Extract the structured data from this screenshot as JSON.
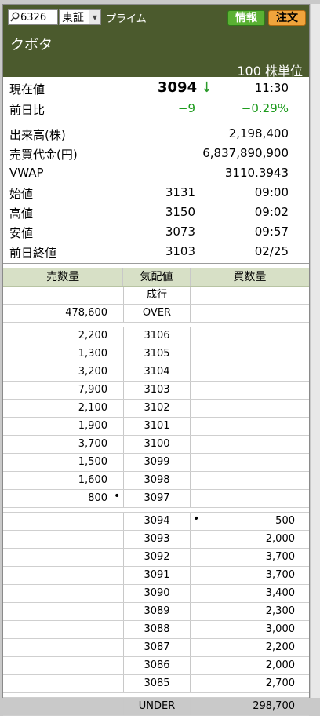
{
  "toolbar": {
    "stock_code": "6326",
    "market": "東証",
    "segment": "プライム",
    "info_button": "情報",
    "order_button": "注文"
  },
  "company": "クボタ",
  "unit": "100 株単位",
  "price": {
    "label_current": "現在値",
    "current": "3094",
    "arrow": "↓",
    "time": "11:30",
    "label_change": "前日比",
    "change": "−9",
    "change_pct": "−0.29%"
  },
  "stats": [
    {
      "label": "出来高(株)",
      "mid": "",
      "right": "2,198,400"
    },
    {
      "label": "売買代金(円)",
      "mid": "",
      "right": "6,837,890,900"
    },
    {
      "label": "VWAP",
      "mid": "",
      "right": "3110.3943"
    },
    {
      "label": "始値",
      "mid": "3131",
      "right": "09:00"
    },
    {
      "label": "高値",
      "mid": "3150",
      "right": "09:02"
    },
    {
      "label": "安値",
      "mid": "3073",
      "right": "09:57"
    },
    {
      "label": "前日終値",
      "mid": "3103",
      "right": "02/25"
    }
  ],
  "board": {
    "headers": [
      "売数量",
      "気配値",
      "買数量"
    ],
    "market_order": "成行",
    "over": {
      "sell": "478,600",
      "label": "OVER"
    },
    "asks": [
      {
        "qty": "2,200",
        "price": "3106"
      },
      {
        "qty": "1,300",
        "price": "3105"
      },
      {
        "qty": "3,200",
        "price": "3104"
      },
      {
        "qty": "7,900",
        "price": "3103"
      },
      {
        "qty": "2,100",
        "price": "3102"
      },
      {
        "qty": "1,900",
        "price": "3101"
      },
      {
        "qty": "3,700",
        "price": "3100"
      },
      {
        "qty": "1,500",
        "price": "3099"
      },
      {
        "qty": "1,600",
        "price": "3098"
      },
      {
        "qty": "800",
        "price": "3097"
      }
    ],
    "bids": [
      {
        "price": "3094",
        "qty": "500"
      },
      {
        "price": "3093",
        "qty": "2,000"
      },
      {
        "price": "3092",
        "qty": "3,700"
      },
      {
        "price": "3091",
        "qty": "3,700"
      },
      {
        "price": "3090",
        "qty": "3,400"
      },
      {
        "price": "3089",
        "qty": "2,300"
      },
      {
        "price": "3088",
        "qty": "3,000"
      },
      {
        "price": "3087",
        "qty": "2,200"
      },
      {
        "price": "3086",
        "qty": "2,000"
      },
      {
        "price": "3085",
        "qty": "2,700"
      }
    ],
    "under": {
      "label": "UNDER",
      "buy": "298,700"
    },
    "marker": "•"
  },
  "colors": {
    "header_bg": "#4b5a2d",
    "info_btn": "#5ab133",
    "order_btn": "#f0a43c",
    "down": "#1a9a1a"
  }
}
